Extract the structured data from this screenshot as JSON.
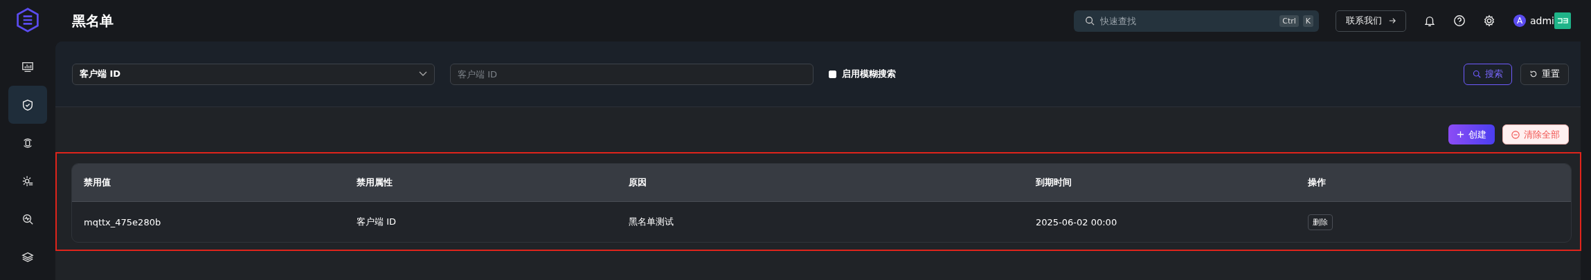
{
  "sidebar": {
    "items": [
      {
        "kind": "monitor",
        "selected": false
      },
      {
        "kind": "shield",
        "selected": true
      },
      {
        "kind": "sync",
        "selected": false
      },
      {
        "kind": "gear",
        "selected": false
      },
      {
        "kind": "analyze",
        "selected": false
      },
      {
        "kind": "layers",
        "selected": false
      }
    ]
  },
  "header": {
    "title": "黑名单",
    "search": {
      "placeholder": "快速查找",
      "keys": [
        "Ctrl",
        "K"
      ]
    },
    "contact_button": "联系我们",
    "avatar": "A",
    "user": "admi"
  },
  "filter": {
    "field_select": "客户端 ID",
    "value_input": {
      "placeholder": "客户端 ID"
    },
    "fuzzy": {
      "label": "启用模糊搜索",
      "checked": false
    },
    "search_button": "搜索",
    "reset_button": "重置"
  },
  "actions": {
    "create_button": "创建",
    "clear_button": "清除全部"
  },
  "table": {
    "columns": [
      "禁用值",
      "禁用属性",
      "原因",
      "到期时间",
      "操作"
    ],
    "rows": [
      {
        "cells": [
          "mqttx_475e280b",
          "客户端 ID",
          "黑名单测试",
          "2025-06-02 00:00"
        ],
        "action": "删除"
      }
    ]
  }
}
